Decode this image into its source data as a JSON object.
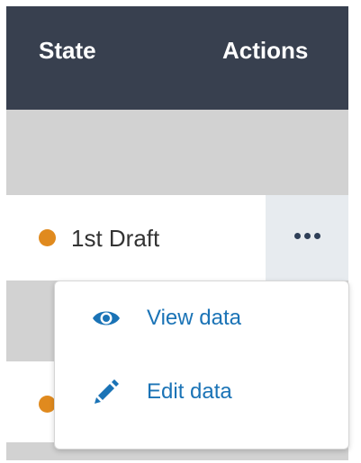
{
  "header": {
    "state_label": "State",
    "actions_label": "Actions"
  },
  "rows": [
    {
      "state": "1st Draft",
      "status_color": "#e08a1e"
    },
    {
      "state": "",
      "status_color": "#e08a1e"
    }
  ],
  "menu": {
    "items": [
      {
        "label": "View data",
        "icon": "eye-icon"
      },
      {
        "label": "Edit data",
        "icon": "pencil-icon"
      }
    ]
  },
  "colors": {
    "header_bg": "#38404f",
    "link": "#1a73b6",
    "status_orange": "#e08a1e"
  }
}
